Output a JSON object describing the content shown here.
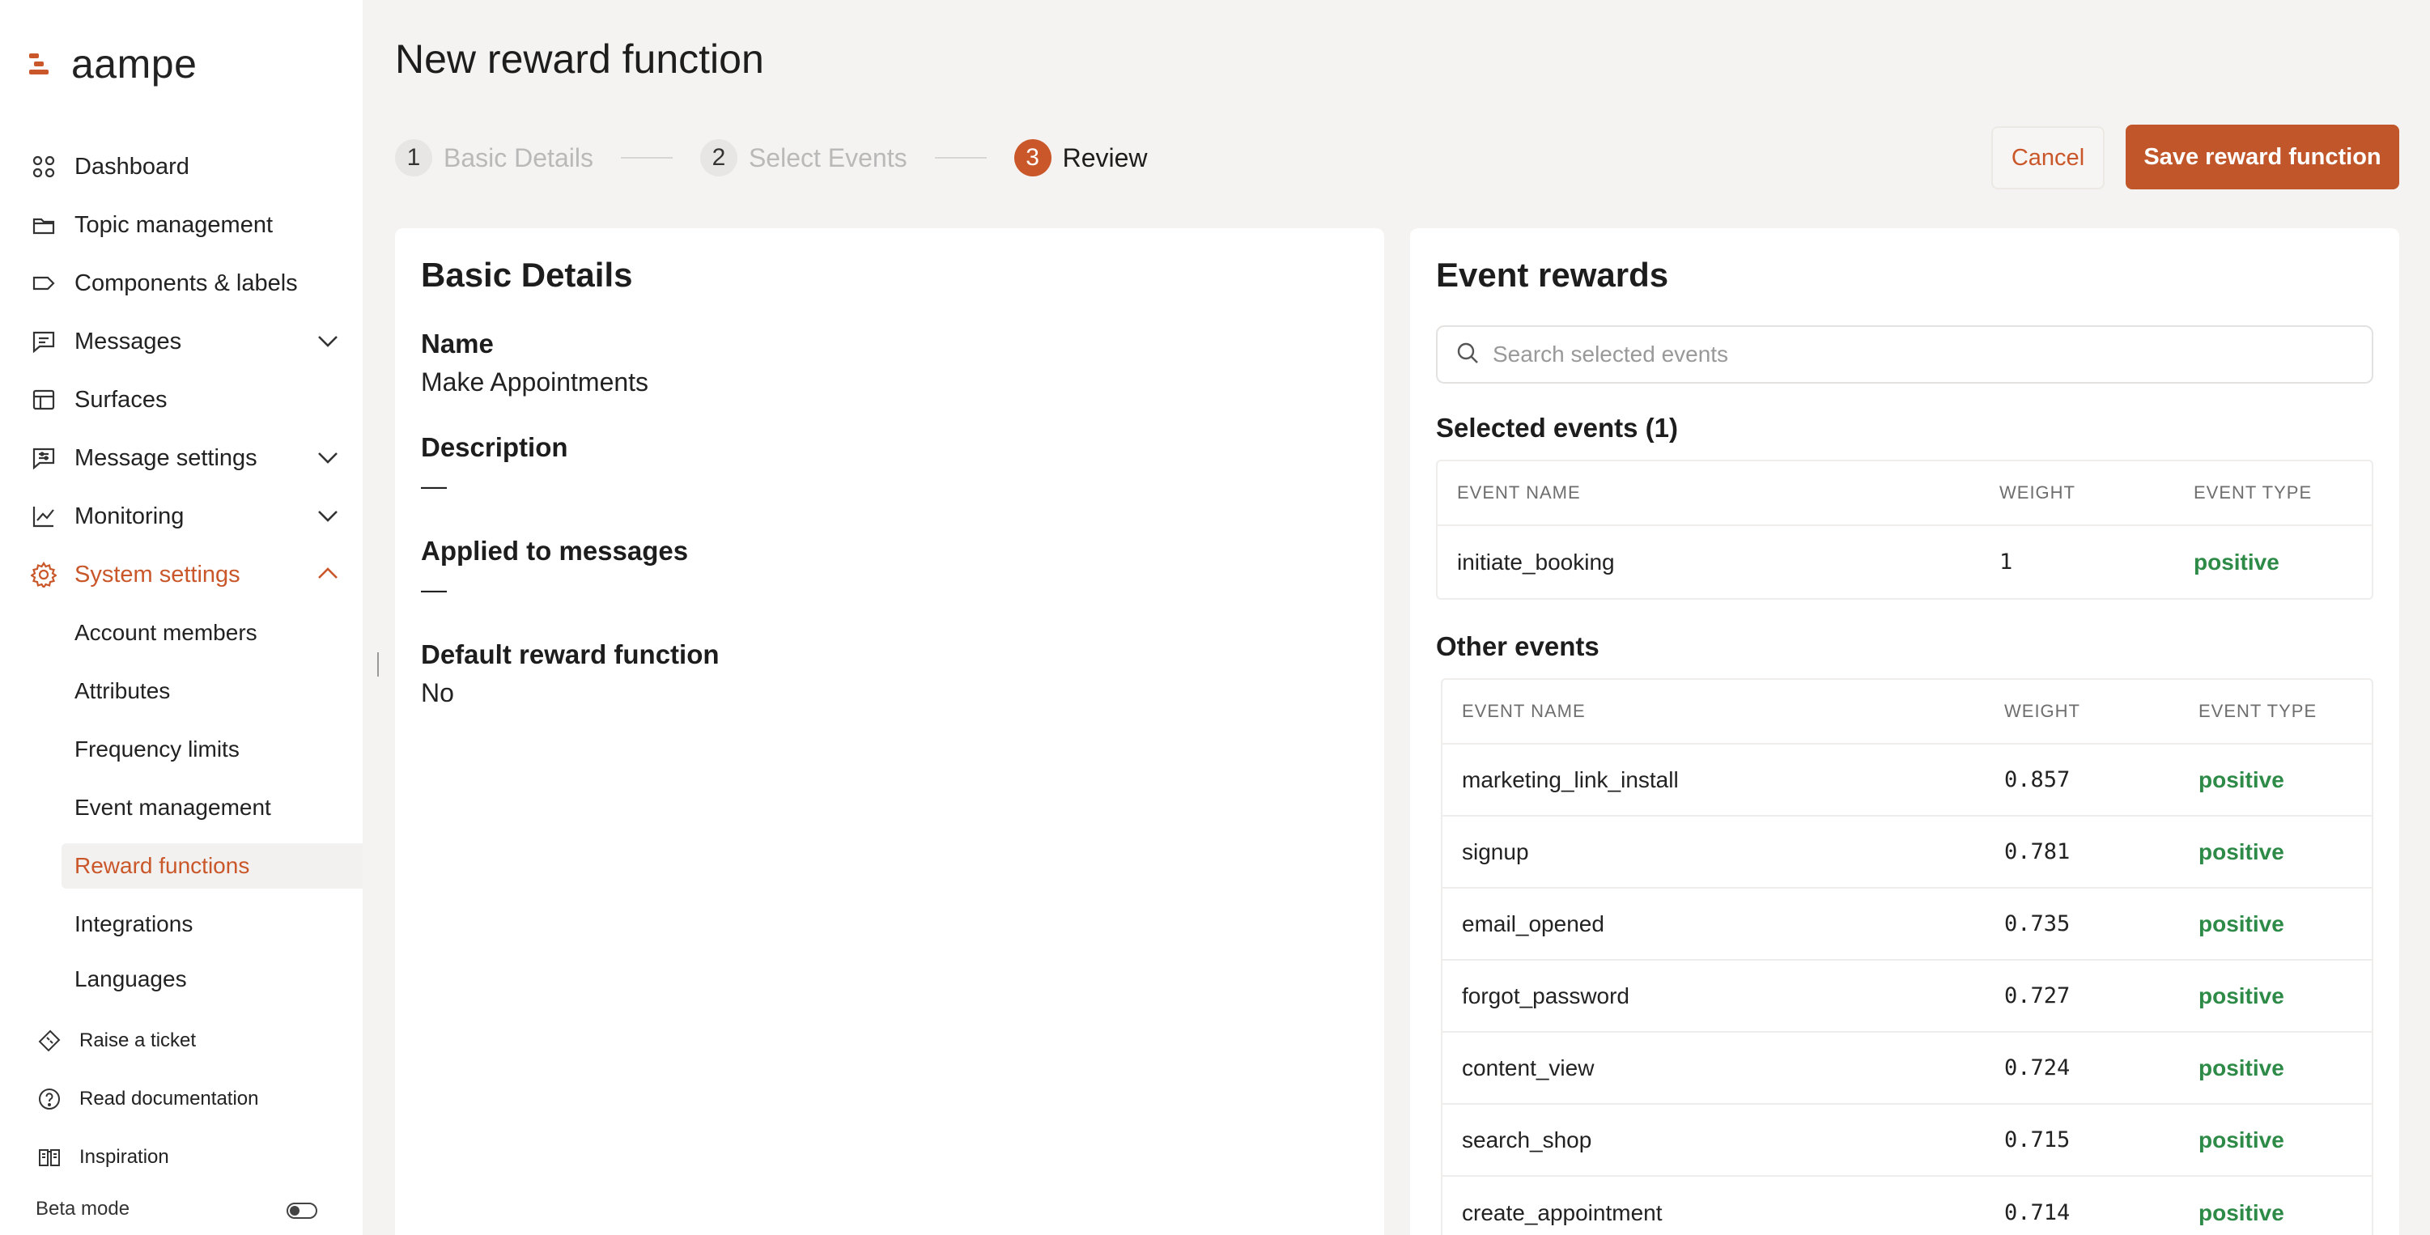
{
  "app": {
    "logo_text": "aampe",
    "brand_color": "#c9572a"
  },
  "sidebar": {
    "items": [
      {
        "label": "Dashboard",
        "icon": "grid-icon"
      },
      {
        "label": "Topic management",
        "icon": "folder-icon"
      },
      {
        "label": "Components & labels",
        "icon": "label-icon"
      },
      {
        "label": "Messages",
        "icon": "message-icon",
        "expandable": true
      },
      {
        "label": "Surfaces",
        "icon": "table-icon"
      },
      {
        "label": "Message settings",
        "icon": "message-settings-icon",
        "expandable": true
      },
      {
        "label": "Monitoring",
        "icon": "chart-icon",
        "expandable": true
      },
      {
        "label": "System settings",
        "icon": "gear-icon",
        "expanded": true,
        "active": true
      }
    ],
    "system_settings_children": [
      {
        "label": "Account members"
      },
      {
        "label": "Attributes"
      },
      {
        "label": "Frequency limits"
      },
      {
        "label": "Event management"
      },
      {
        "label": "Reward functions",
        "selected": true
      },
      {
        "label": "Integrations"
      },
      {
        "label": "Languages"
      }
    ],
    "footer": [
      {
        "label": "Raise a ticket",
        "icon": "ticket-icon"
      },
      {
        "label": "Read documentation",
        "icon": "help-icon"
      },
      {
        "label": "Inspiration",
        "icon": "book-icon"
      }
    ],
    "beta_mode_label": "Beta mode",
    "beta_mode_on": false
  },
  "header": {
    "title": "New reward function",
    "steps": [
      {
        "number": "1",
        "label": "Basic Details"
      },
      {
        "number": "2",
        "label": "Select Events"
      },
      {
        "number": "3",
        "label": "Review",
        "current": true
      }
    ],
    "cancel_label": "Cancel",
    "save_label": "Save reward function"
  },
  "basic_details": {
    "title": "Basic Details",
    "name_label": "Name",
    "name_value": "Make Appointments",
    "description_label": "Description",
    "description_value": "—",
    "applied_label": "Applied to messages",
    "applied_value": "—",
    "default_label": "Default reward function",
    "default_value": "No"
  },
  "event_rewards": {
    "title": "Event rewards",
    "search_placeholder": "Search selected events",
    "selected_title": "Selected events (1)",
    "columns": {
      "name": "EVENT NAME",
      "weight": "WEIGHT",
      "type": "EVENT TYPE"
    },
    "selected_events": [
      {
        "name": "initiate_booking",
        "weight": "1",
        "type": "positive"
      }
    ],
    "other_title": "Other events",
    "other_events": [
      {
        "name": "marketing_link_install",
        "weight": "0.857",
        "type": "positive"
      },
      {
        "name": "signup",
        "weight": "0.781",
        "type": "positive"
      },
      {
        "name": "email_opened",
        "weight": "0.735",
        "type": "positive"
      },
      {
        "name": "forgot_password",
        "weight": "0.727",
        "type": "positive"
      },
      {
        "name": "content_view",
        "weight": "0.724",
        "type": "positive"
      },
      {
        "name": "search_shop",
        "weight": "0.715",
        "type": "positive"
      },
      {
        "name": "create_appointment",
        "weight": "0.714",
        "type": "positive"
      }
    ],
    "positive_color": "#2d8a47"
  }
}
